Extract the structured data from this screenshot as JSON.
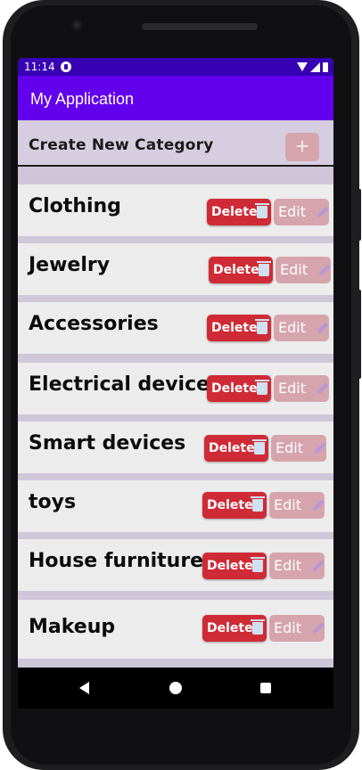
{
  "status_bar": {
    "time": "11:14"
  },
  "app_bar": {
    "title": "My Application"
  },
  "create": {
    "label": "Create New Category",
    "add_symbol": "+"
  },
  "buttons": {
    "delete_label": "Delete",
    "edit_label": "Edit"
  },
  "categories": [
    {
      "name": "Clothing"
    },
    {
      "name": "Jewelry"
    },
    {
      "name": "Accessories"
    },
    {
      "name": "Electrical devices"
    },
    {
      "name": "Smart devices"
    },
    {
      "name": "toys"
    },
    {
      "name": "House furniture"
    },
    {
      "name": "Makeup"
    }
  ],
  "colors": {
    "status_bar": "#3700b3",
    "app_bar": "#6200ee",
    "delete_button": "#cf2b36",
    "edit_button": "#d6a4ad",
    "row_background": "#ececec",
    "list_background": "#cfc6da"
  },
  "icons": {
    "add": "plus-icon",
    "delete": "trash-icon",
    "edit": "pencil-icon"
  }
}
